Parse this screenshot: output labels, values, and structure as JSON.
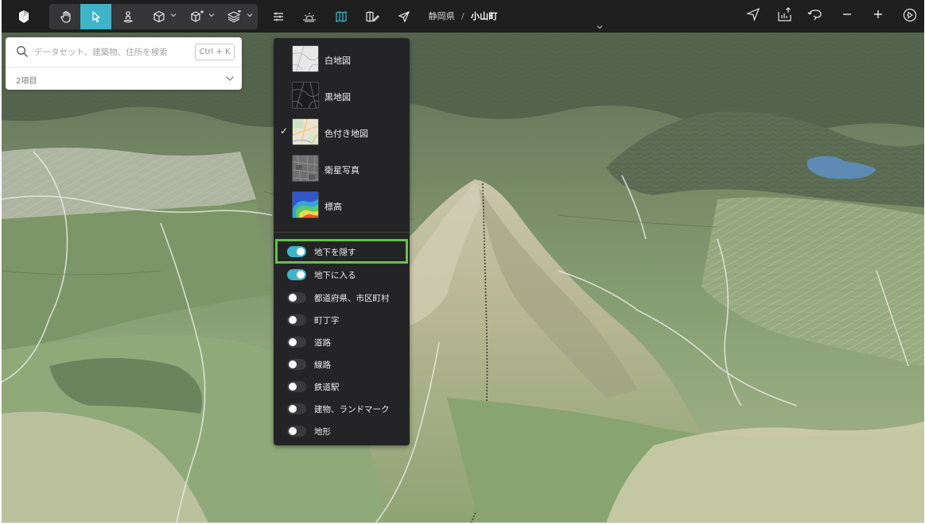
{
  "toolbar": {
    "left_icons": [
      "app-logo-icon",
      "hand-pan-icon",
      "pointer-icon",
      "person-marker-icon",
      "cube-icon",
      "building-plus-icon",
      "layers-stack-icon",
      "sliders-icon",
      "sun-horizon-icon",
      "map-book-icon",
      "map-edit-icon",
      "send-arrow-icon"
    ],
    "active_tool": "pointer-icon",
    "right_icons": [
      "navigation-arrow-icon",
      "export-icon",
      "undo-circle-icon",
      "zoom-out-icon",
      "zoom-in-icon",
      "play-circle-icon"
    ]
  },
  "breadcrumb": {
    "prefecture": "静岡県",
    "separator": "/",
    "town": "小山町"
  },
  "search": {
    "placeholder": "データセット、建築物、住所を検索",
    "shortcut": "Ctrl + K",
    "result_count": "2項目"
  },
  "basemap_menu": {
    "options": [
      {
        "label": "白地図",
        "selected": false,
        "icon": "white-map-thumbnail"
      },
      {
        "label": "黒地図",
        "selected": false,
        "icon": "black-map-thumbnail"
      },
      {
        "label": "色付き地図",
        "selected": true,
        "icon": "color-map-thumbnail"
      },
      {
        "label": "衛星写真",
        "selected": false,
        "icon": "satellite-thumbnail"
      },
      {
        "label": "標高",
        "selected": false,
        "icon": "elevation-thumbnail"
      }
    ],
    "check_mark": "✓",
    "toggles": [
      {
        "label": "地下を隠す",
        "on": true,
        "highlighted": true
      },
      {
        "label": "地下に入る",
        "on": true
      },
      {
        "label": "都道府県、市区町村",
        "on": false
      },
      {
        "label": "町丁字",
        "on": false
      },
      {
        "label": "道路",
        "on": false
      },
      {
        "label": "線路",
        "on": false
      },
      {
        "label": "鉄道駅",
        "on": false
      },
      {
        "label": "建物、ランドマーク",
        "on": false
      },
      {
        "label": "地形",
        "on": false
      }
    ]
  },
  "colors": {
    "toolbar_bg": "#1f1f20",
    "accent": "#3fb3c7",
    "highlight": "#6abf4b",
    "menu_bg": "#242426"
  }
}
